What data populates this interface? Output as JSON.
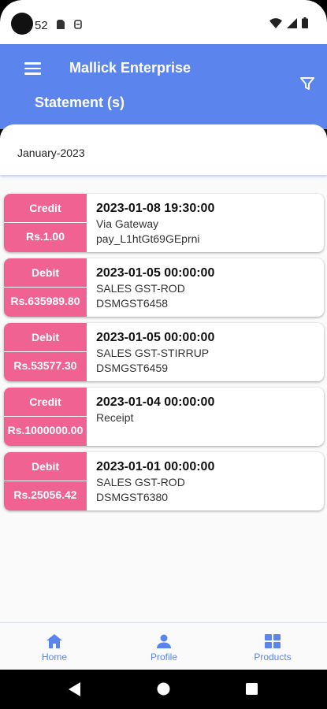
{
  "status_bar": {
    "time": "52"
  },
  "app_bar": {
    "title": "Mallick Enterprise",
    "subtitle": "Statement (s)"
  },
  "month": {
    "label": "January-2023"
  },
  "entries": [
    {
      "type": "Credit",
      "amount": "Rs.1.00",
      "datetime": "2023-01-08 19:30:00",
      "line1": "Via Gateway",
      "line2": "pay_L1htGt69GEprni"
    },
    {
      "type": "Debit",
      "amount": "Rs.635989.80",
      "datetime": "2023-01-05 00:00:00",
      "line1": "SALES GST-ROD",
      "line2": "DSMGST6458"
    },
    {
      "type": "Debit",
      "amount": "Rs.53577.30",
      "datetime": "2023-01-05 00:00:00",
      "line1": "SALES GST-STIRRUP",
      "line2": "DSMGST6459"
    },
    {
      "type": "Credit",
      "amount": "Rs.1000000.00",
      "datetime": "2023-01-04 00:00:00",
      "line1": "Receipt",
      "line2": ""
    },
    {
      "type": "Debit",
      "amount": "Rs.25056.42",
      "datetime": "2023-01-01 00:00:00",
      "line1": "SALES GST-ROD",
      "line2": "DSMGST6380"
    }
  ],
  "bottom_nav": {
    "home": "Home",
    "profile": "Profile",
    "products": "Products"
  },
  "colors": {
    "primary": "#5b84ec",
    "tag": "#f06292",
    "background": "#fafafa"
  },
  "icons": {
    "menu": "menu-icon",
    "filter": "filter-icon",
    "home": "home-icon",
    "profile": "person-icon",
    "products": "grid-icon"
  }
}
